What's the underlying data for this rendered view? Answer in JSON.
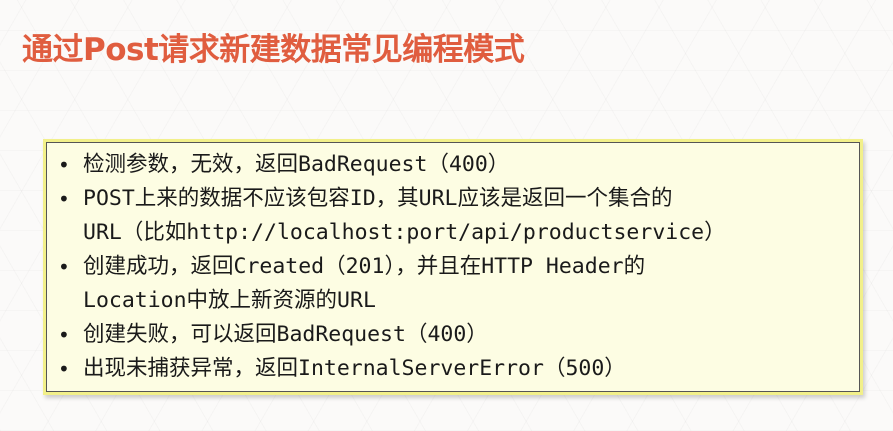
{
  "slide": {
    "title": "通过Post请求新建数据常见编程模式",
    "title_color": "#e05d3f",
    "box_background": "#fdfde3",
    "box_border_color": "#f2f08a",
    "bullet_symbol": "•",
    "bullets": [
      "检测参数，无效，返回BadRequest（400）",
      "POST上来的数据不应该包容ID，其URL应该是返回一个集合的\nURL（比如http://localhost:port/api/productservice）",
      "创建成功，返回Created（201），并且在HTTP Header的\nLocation中放上新资源的URL",
      "创建失败，可以返回BadRequest（400）",
      "出现未捕获异常，返回InternalServerError（500）"
    ]
  }
}
